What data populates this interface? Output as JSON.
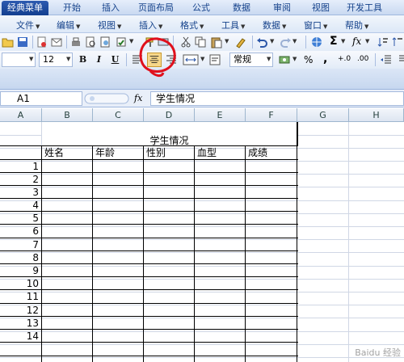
{
  "tabs": [
    "经典菜单",
    "开始",
    "插入",
    "页面布局",
    "公式",
    "数据",
    "审阅",
    "视图",
    "开发工具"
  ],
  "menus": [
    "文件",
    "编辑",
    "视图",
    "插入",
    "格式",
    "工具",
    "数据",
    "窗口",
    "帮助"
  ],
  "toolbar": {
    "font_size": "12",
    "bold": "B",
    "italic": "I",
    "underline": "U",
    "number_format": "常规",
    "percent": "%",
    "comma": ",",
    "inc_decimal": "+.0",
    "dec_decimal": ".00"
  },
  "formula_bar": {
    "cell_ref": "A1",
    "fx": "fx",
    "formula": "学生情况"
  },
  "columns": [
    "A",
    "B",
    "C",
    "D",
    "E",
    "F",
    "G",
    "H"
  ],
  "sheet": {
    "title": "学生情况",
    "headers": [
      "姓名",
      "年龄",
      "性别",
      "血型",
      "成绩"
    ],
    "row_numbers": [
      "1",
      "2",
      "3",
      "4",
      "5",
      "6",
      "7",
      "8",
      "9",
      "10",
      "11",
      "12",
      "13",
      "14"
    ]
  },
  "colors": {
    "annotation": "#e0101c",
    "active_tab": "#1f4c9e"
  },
  "watermark": "Baidu 经验"
}
